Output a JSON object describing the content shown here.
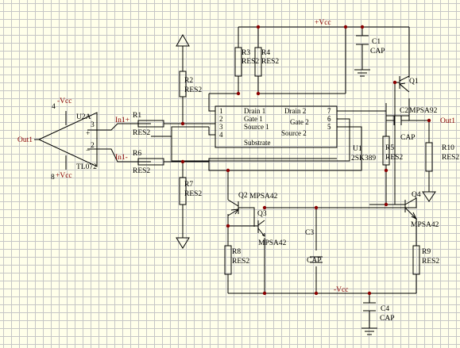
{
  "labels": {
    "vcc_top": "+Vcc",
    "vcc_bottom": "-Vcc",
    "opamp_neg_supply": "-Vcc",
    "opamp_pos_supply": "+Vcc",
    "out1_left": "Out1",
    "out1_right": "Out1",
    "in1_plus": "In1+",
    "in1_minus": "In1-"
  },
  "components": {
    "u2": {
      "ref": "U2A",
      "value": "TL072",
      "pin3": "3",
      "pin2": "2",
      "pin4": "4",
      "pin8": "8",
      "plus": "+",
      "minus": "−"
    },
    "u1": {
      "ref": "U1",
      "value": "2SK389",
      "pins": [
        {
          "num": "1",
          "name": "Drain 1"
        },
        {
          "num": "2",
          "name": "Gate 1"
        },
        {
          "num": "3",
          "name": "Source 1"
        },
        {
          "num": "4",
          "name": "Substrate"
        }
      ],
      "pins_right": [
        {
          "num": "7",
          "name": "Drain 2"
        },
        {
          "num": "6",
          "name": "Gate 2"
        },
        {
          "num": "5",
          "name": "Source 2"
        }
      ]
    },
    "r1": {
      "ref": "R1",
      "value": "RES2"
    },
    "r2": {
      "ref": "R2",
      "value": "RES2"
    },
    "r3": {
      "ref": "R3",
      "value": "RES2"
    },
    "r4": {
      "ref": "R4",
      "value": "RES2"
    },
    "r5": {
      "ref": "R5",
      "value": "RES2"
    },
    "r6": {
      "ref": "R6",
      "value": "RES2"
    },
    "r7": {
      "ref": "R7",
      "value": "RES2"
    },
    "r8": {
      "ref": "R8",
      "value": "RES2"
    },
    "r9": {
      "ref": "R9",
      "value": "RES2"
    },
    "r10": {
      "ref": "R10",
      "value": "RES2"
    },
    "c1": {
      "ref": "C1",
      "value": "CAP"
    },
    "c2": {
      "ref": "C2",
      "value": "CAP"
    },
    "c3": {
      "ref": "C3",
      "value": "CAP"
    },
    "c4": {
      "ref": "C4",
      "value": "CAP"
    },
    "q1": {
      "ref": "Q1",
      "value": "MPSA92"
    },
    "q2": {
      "ref": "Q2",
      "value": "MPSA42"
    },
    "q3": {
      "ref": "Q3",
      "value": "MPSA42"
    },
    "q4": {
      "ref": "Q4",
      "value": "MPSA42"
    }
  }
}
